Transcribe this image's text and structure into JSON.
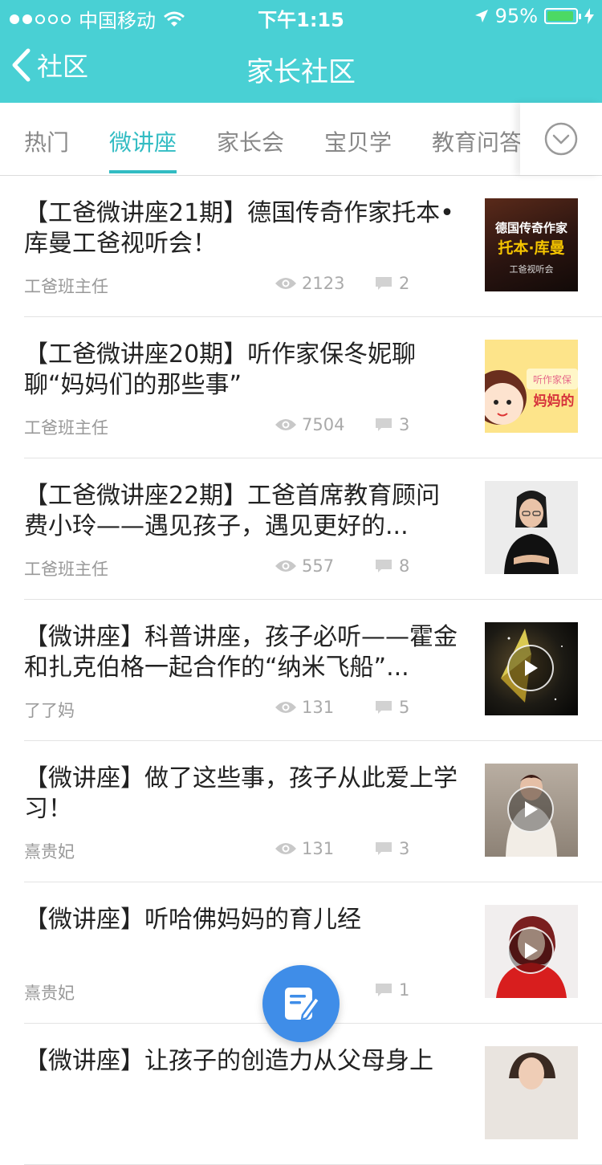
{
  "status_bar": {
    "carrier": "中国移动",
    "time": "下午1:15",
    "battery": "95%",
    "battery_level": 0.95,
    "signal_bars": 2
  },
  "nav": {
    "back_label": "社区",
    "title": "家长社区"
  },
  "tabs": [
    {
      "label": "热门",
      "active": false
    },
    {
      "label": "微讲座",
      "active": true
    },
    {
      "label": "家长会",
      "active": false
    },
    {
      "label": "宝贝学",
      "active": false
    },
    {
      "label": "教育问答",
      "active": false
    }
  ],
  "colors": {
    "accent": "#32bcc3",
    "header": "#49d0d4",
    "fab": "#3f8de8"
  },
  "posts": [
    {
      "title": "【工爸微讲座21期】德国传奇作家托本•库曼工爸视听会！",
      "author": "工爸班主任",
      "views": "2123",
      "comments": "2",
      "thumb_lines": [
        "德国传奇作家",
        "托本·库曼",
        "工爸视听会"
      ],
      "video": false
    },
    {
      "title": "【工爸微讲座20期】听作家保冬妮聊聊“妈妈们的那些事”",
      "author": "工爸班主任",
      "views": "7504",
      "comments": "3",
      "thumb_lines": [
        "听作家保",
        "妈妈的"
      ],
      "video": false
    },
    {
      "title": "【工爸微讲座22期】工爸首席教育顾问费小玲——遇见孩子，遇见更好的...",
      "author": "工爸班主任",
      "views": "557",
      "comments": "8",
      "video": false
    },
    {
      "title": "【微讲座】科普讲座，孩子必听——霍金和扎克伯格一起合作的“纳米飞船”...",
      "author": "了了妈",
      "views": "131",
      "comments": "5",
      "video": true
    },
    {
      "title": "【微讲座】做了这些事，孩子从此爱上学习！",
      "author": "熹贵妃",
      "views": "131",
      "comments": "3",
      "video": true
    },
    {
      "title": "【微讲座】听哈佛妈妈的育儿经",
      "author": "熹贵妃",
      "views": "",
      "comments": "1",
      "video": true
    },
    {
      "title": "【微讲座】让孩子的创造力从父母身上",
      "author": "",
      "views": "",
      "comments": "",
      "video": false
    }
  ],
  "icons": {
    "back": "chevron-left-icon",
    "more_tabs": "chevron-down-circle-icon",
    "views": "eye-icon",
    "comments": "comment-icon",
    "fab": "compose-icon"
  }
}
